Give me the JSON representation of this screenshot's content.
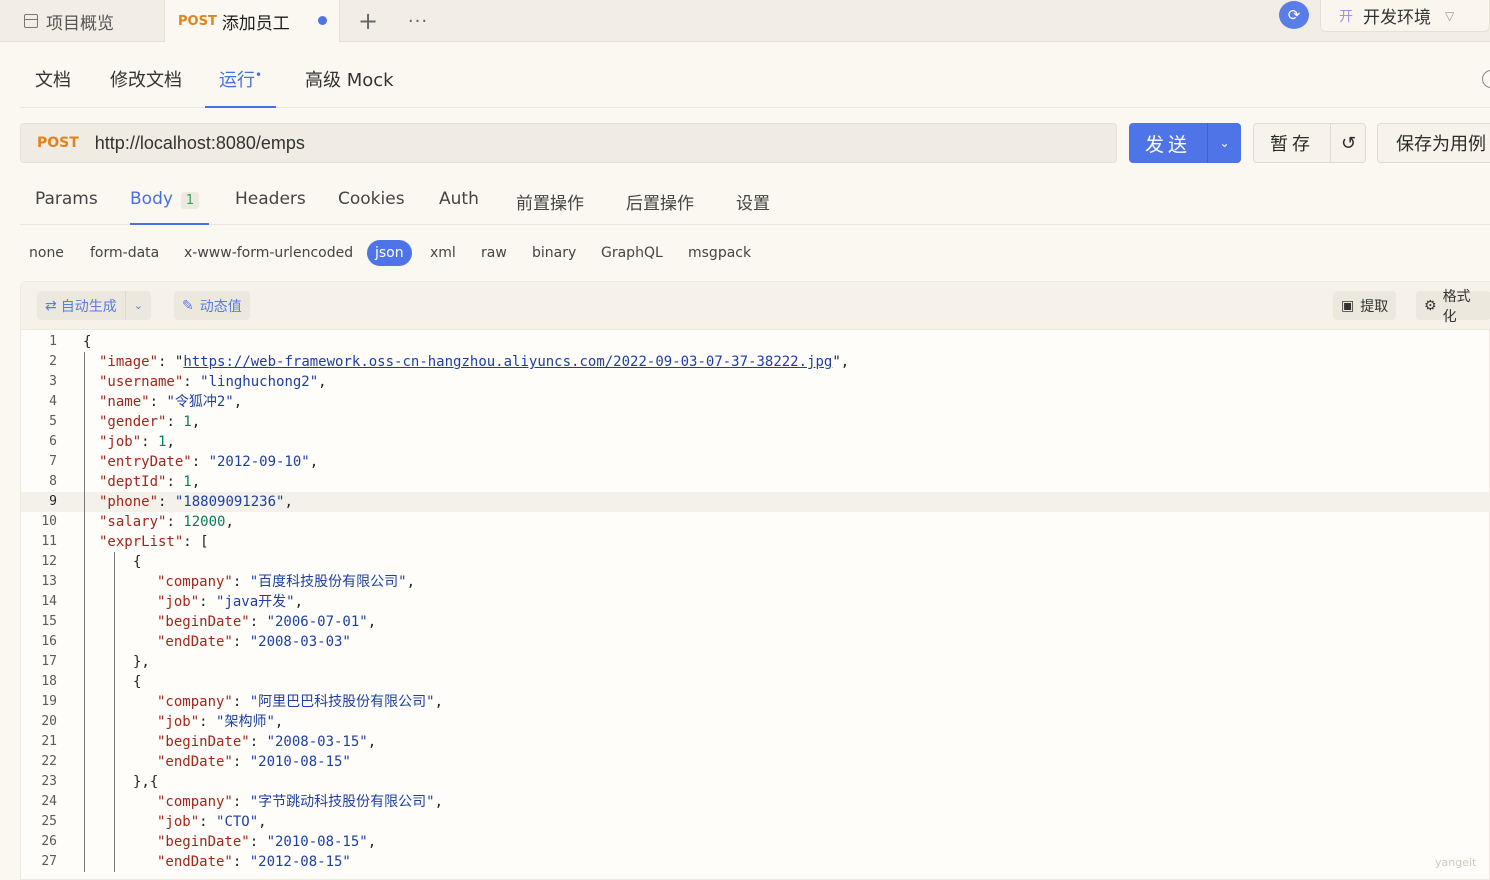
{
  "topbar": {
    "overview_label": "项目概览",
    "active_tab_method": "POST",
    "active_tab_title": "添加员工",
    "plus": "+",
    "more": "···",
    "env_badge": "开",
    "env_label": "开发环境"
  },
  "subtabs": [
    "文档",
    "修改文档",
    "运行",
    "高级 Mock"
  ],
  "active_subtab_dot": "•",
  "request": {
    "method": "POST",
    "url": "http://localhost:8080/emps",
    "send_label": "发送",
    "stash_label": "暂存",
    "save_case_label": "保存为用例"
  },
  "req_tabs": [
    "Params",
    "Body",
    "Headers",
    "Cookies",
    "Auth",
    "前置操作",
    "后置操作",
    "设置"
  ],
  "body_count": "1",
  "body_types": [
    "none",
    "form-data",
    "x-www-form-urlencoded",
    "json",
    "xml",
    "raw",
    "binary",
    "GraphQL",
    "msgpack"
  ],
  "body_type_selected": "json",
  "editor_toolbar": {
    "auto_generate": "自动生成",
    "dynamic_value": "动态值",
    "extract": "提取",
    "format": "格式化"
  },
  "code_lines": [
    "{",
    "\"image\": \"https://web-framework.oss-cn-hangzhou.aliyuncs.com/2022-09-03-07-37-38222.jpg\",",
    "\"username\": \"linghuchong2\",",
    "\"name\": \"令狐冲2\",",
    "\"gender\": 1,",
    "\"job\": 1,",
    "\"entryDate\": \"2012-09-10\",",
    "\"deptId\": 1,",
    "\"phone\": \"18809091236\",",
    "\"salary\": 12000,",
    "\"exprList\": [",
    "{",
    "\"company\": \"百度科技股份有限公司\",",
    "\"job\": \"java开发\",",
    "\"beginDate\": \"2006-07-01\",",
    "\"endDate\": \"2008-03-03\"",
    "},",
    "{",
    "\"company\": \"阿里巴巴科技股份有限公司\",",
    "\"job\": \"架构师\",",
    "\"beginDate\": \"2008-03-15\",",
    "\"endDate\": \"2010-08-15\"",
    "},{",
    "\"company\": \"字节跳动科技股份有限公司\",",
    "\"job\": \"CTO\",",
    "\"beginDate\": \"2010-08-15\",",
    "\"endDate\": \"2012-08-15\""
  ],
  "current_line": 9,
  "watermark": "yangeit",
  "colors": {
    "accent": "#4f74e8",
    "post": "#e3821b",
    "key": "#a1261c",
    "string": "#1d3fa4",
    "number": "#0c7d5b"
  }
}
